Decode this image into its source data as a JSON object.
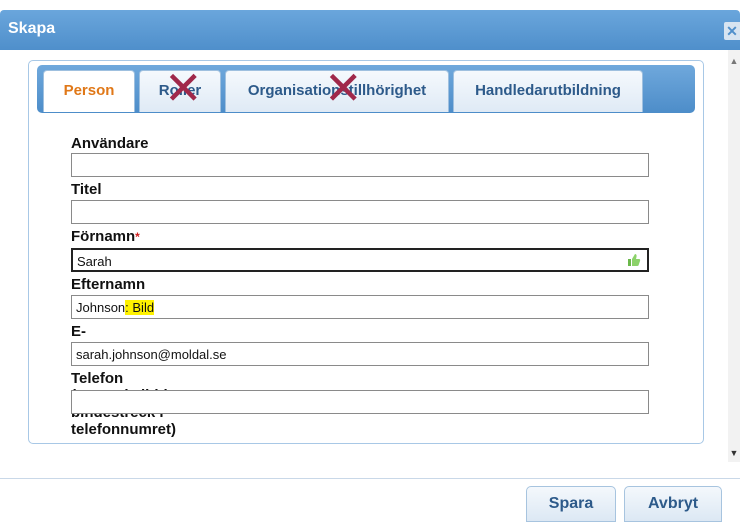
{
  "dialog": {
    "title": "Skapa",
    "close_glyph": "✕"
  },
  "tabs": [
    {
      "label": "Person",
      "active": true
    },
    {
      "label": "Roller",
      "crossed_out": true
    },
    {
      "label": "Organisationstillhörighet",
      "crossed_out": true
    },
    {
      "label": "Handledarutbildning"
    }
  ],
  "cross_glyph": "✕",
  "fields": {
    "user": {
      "label": "Användare",
      "value": ""
    },
    "title": {
      "label": "Titel",
      "value": ""
    },
    "firstname": {
      "label": "Förnamn",
      "required_mark": "*",
      "value": "Sarah",
      "icon": "thumbs-up-icon"
    },
    "lastname": {
      "label": "Efternamn",
      "value_prefix": "Johnson",
      "value_highlighted": ": Bild"
    },
    "email": {
      "label": "E-post",
      "value": "sarah.johnson@moldal.se"
    },
    "phone": {
      "label": "Telefon (använd alltid bindestreck i telefonnumret)",
      "value": ""
    }
  },
  "buttons": {
    "save": "Spara",
    "cancel": "Avbryt"
  },
  "colors": {
    "header_blue": "#4f8fcb",
    "active_tab_text": "#e07818",
    "tab_text": "#2d5a8a",
    "cross_mark": "#a0284a",
    "highlight": "#fff200",
    "required": "#d02020"
  },
  "scrollbar": {
    "up_glyph": "▲",
    "down_glyph": "▼"
  }
}
